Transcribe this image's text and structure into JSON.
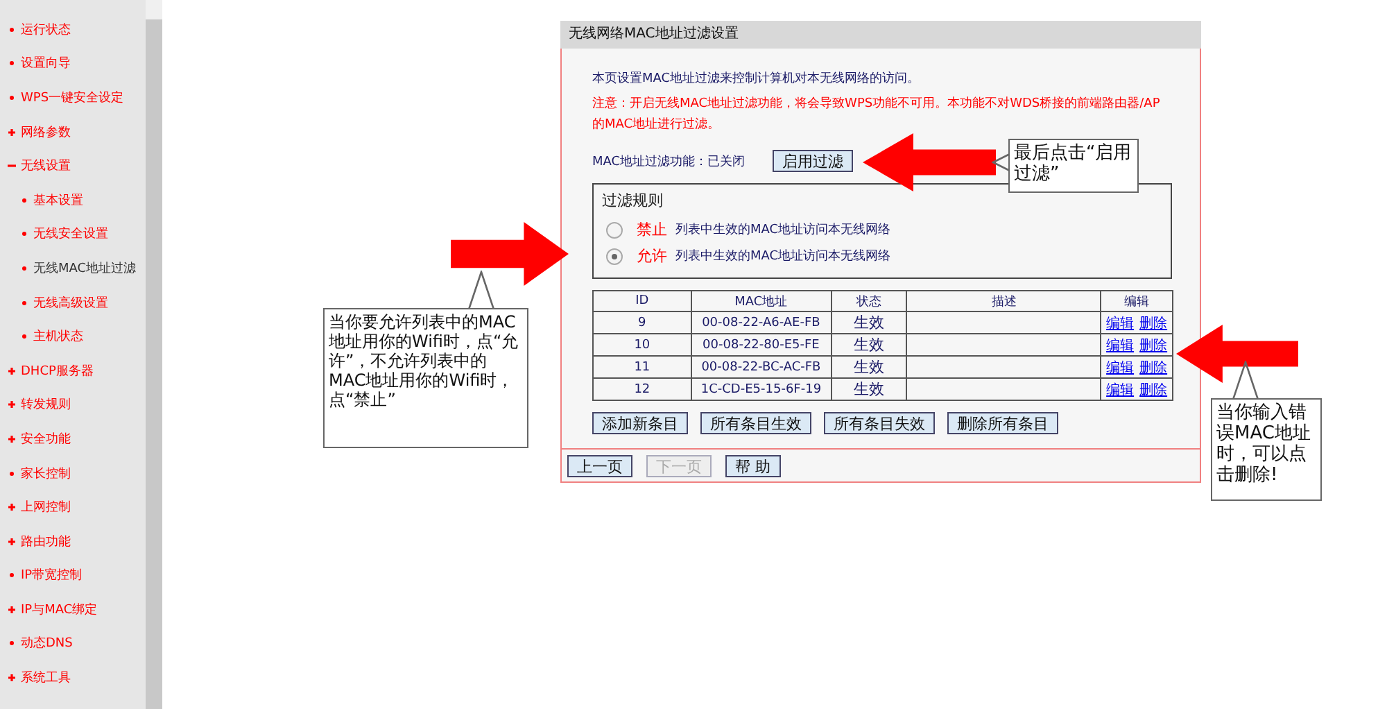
{
  "sidebar": {
    "items": [
      {
        "label": "运行状态",
        "kind": "leaf",
        "selected": false
      },
      {
        "label": "设置向导",
        "kind": "leaf",
        "selected": false
      },
      {
        "label": "WPS一键安全设定",
        "kind": "leaf",
        "selected": false
      },
      {
        "label": "网络参数",
        "kind": "collapsed",
        "selected": false
      },
      {
        "label": "无线设置",
        "kind": "expanded",
        "selected": false,
        "children": [
          {
            "label": "基本设置",
            "kind": "leaf",
            "selected": false
          },
          {
            "label": "无线安全设置",
            "kind": "leaf",
            "selected": false
          },
          {
            "label": "无线MAC地址过滤",
            "kind": "leaf",
            "selected": true
          },
          {
            "label": "无线高级设置",
            "kind": "leaf",
            "selected": false
          },
          {
            "label": "主机状态",
            "kind": "leaf",
            "selected": false
          }
        ]
      },
      {
        "label": "DHCP服务器",
        "kind": "collapsed",
        "selected": false
      },
      {
        "label": "转发规则",
        "kind": "collapsed",
        "selected": false
      },
      {
        "label": "安全功能",
        "kind": "collapsed",
        "selected": false
      },
      {
        "label": "家长控制",
        "kind": "leaf",
        "selected": false
      },
      {
        "label": "上网控制",
        "kind": "collapsed",
        "selected": false
      },
      {
        "label": "路由功能",
        "kind": "collapsed",
        "selected": false
      },
      {
        "label": "IP带宽控制",
        "kind": "leaf",
        "selected": false
      },
      {
        "label": "IP与MAC绑定",
        "kind": "collapsed",
        "selected": false
      },
      {
        "label": "动态DNS",
        "kind": "leaf",
        "selected": false
      },
      {
        "label": "系统工具",
        "kind": "collapsed",
        "selected": false
      }
    ]
  },
  "panel": {
    "title": "无线网络MAC地址过滤设置",
    "intro": "本页设置MAC地址过滤来控制计算机对本无线网络的访问。",
    "warning": "注意：开启无线MAC地址过滤功能，将会导致WPS功能不可用。本功能不对WDS桥接的前端路由器/AP的MAC地址进行过滤。",
    "filter_status": "MAC地址过滤功能：已关闭",
    "enable_button": "启用过滤",
    "rules": {
      "title": "过滤规则",
      "options": [
        {
          "label": "禁止",
          "description": "列表中生效的MAC地址访问本无线网络",
          "selected": false
        },
        {
          "label": "允许",
          "description": "列表中生效的MAC地址访问本无线网络",
          "selected": true
        }
      ]
    },
    "table": {
      "columns": [
        "ID",
        "MAC地址",
        "状态",
        "描述",
        "编辑"
      ],
      "rows": [
        {
          "id": "9",
          "mac": "00-08-22-A6-AE-FB",
          "status": "生效",
          "edit": "编辑",
          "delete": "删除"
        },
        {
          "id": "10",
          "mac": "00-08-22-80-E5-FE",
          "status": "生效",
          "edit": "编辑",
          "delete": "删除"
        },
        {
          "id": "11",
          "mac": "00-08-22-BC-AC-FB",
          "status": "生效",
          "edit": "编辑",
          "delete": "删除"
        },
        {
          "id": "12",
          "mac": "1C-CD-E5-15-6F-19",
          "status": "生效",
          "edit": "编辑",
          "delete": "删除"
        }
      ]
    },
    "actions": [
      "添加新条目",
      "所有条目生效",
      "所有条目失效",
      "删除所有条目"
    ],
    "nav": [
      {
        "label": "上一页",
        "disabled": false
      },
      {
        "label": "下一页",
        "disabled": true
      },
      {
        "label": "帮 助",
        "disabled": false
      }
    ]
  },
  "annotations": [
    {
      "text": "最后点击“启用过滤”"
    },
    {
      "text": "当你要允许列表中的MAC地址用你的Wifi时，点“允许”，不允许列表中的MAC地址用你的Wifi时，点“禁止”"
    },
    {
      "text": "当你输入错误MAC地址时，可以点击删除!"
    }
  ]
}
